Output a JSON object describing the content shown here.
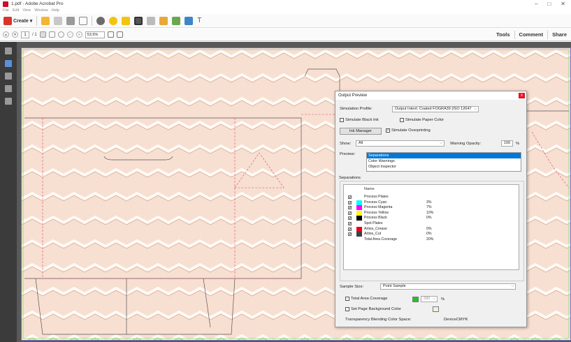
{
  "window": {
    "title": "1.pdf - Adobe Acrobat Pro",
    "controls": [
      "–",
      "□",
      "✕"
    ]
  },
  "menu": [
    "File",
    "Edit",
    "View",
    "Window",
    "Help"
  ],
  "toolbar": {
    "create_label": "Create ▾"
  },
  "nav": {
    "page_current": "1",
    "page_total": "/ 1",
    "zoom": "53,5%",
    "tools_label": "Tools",
    "comment_label": "Comment",
    "share_label": "Share"
  },
  "dialog": {
    "title": "Output Preview",
    "close": "x",
    "simulation_profile_label": "Simulation Profile:",
    "simulation_profile_value": "Output Intent: Coated FOGRA39 (ISO 12647",
    "simulate_black_ink": "Simulate Black Ink",
    "simulate_paper_color": "Simulate Paper Color",
    "ink_manager": "Ink Manager",
    "simulate_overprinting": "Simulate Overprinting",
    "show_label": "Show:",
    "show_value": "All",
    "warning_opacity_label": "Warning Opacity:",
    "warning_opacity_value": "100",
    "percent": "%",
    "preview_label": "Preview:",
    "preview_options": [
      "Separations",
      "Color Warnings",
      "Object Inspector"
    ],
    "separations_group": "Separations",
    "name_header": "Name",
    "separations": [
      {
        "check": "✔",
        "color": "",
        "name": "Process Plates",
        "pct": ""
      },
      {
        "check": "✔",
        "color": "#00ffff",
        "name": "Process Cyan",
        "pct": "3%"
      },
      {
        "check": "✔",
        "color": "#ff00ff",
        "name": "Process Magenta",
        "pct": "7%"
      },
      {
        "check": "✔",
        "color": "#ffff00",
        "name": "Process Yellow",
        "pct": "10%"
      },
      {
        "check": "✔",
        "color": "#000000",
        "name": "Process Black",
        "pct": "0%"
      },
      {
        "check": "✔",
        "color": "",
        "name": "Spot Plates",
        "pct": ""
      },
      {
        "check": "✔",
        "color": "#e8001c",
        "name": "Artios_Crease",
        "pct": "0%"
      },
      {
        "check": "✔",
        "color": "#404040",
        "name": "Artios_Cut",
        "pct": "0%"
      },
      {
        "check": "",
        "color": "",
        "name": "Total Area Coverage",
        "pct": "20%"
      }
    ],
    "sample_size_label": "Sample Size:",
    "sample_size_value": "Point Sample",
    "total_area_coverage": "Total Area Coverage",
    "tac_value": "280",
    "set_page_bg": "Set Page Background Color",
    "blending_label": "Transparency Blending Color Space:",
    "blending_value": "DeviceCMYK"
  },
  "colors": {
    "page_bg": "#f7dfd2",
    "canvas_bg": "#595959",
    "rail_bg": "#3b3b3b",
    "selection": "#0078d7",
    "close_red": "#e81123"
  }
}
